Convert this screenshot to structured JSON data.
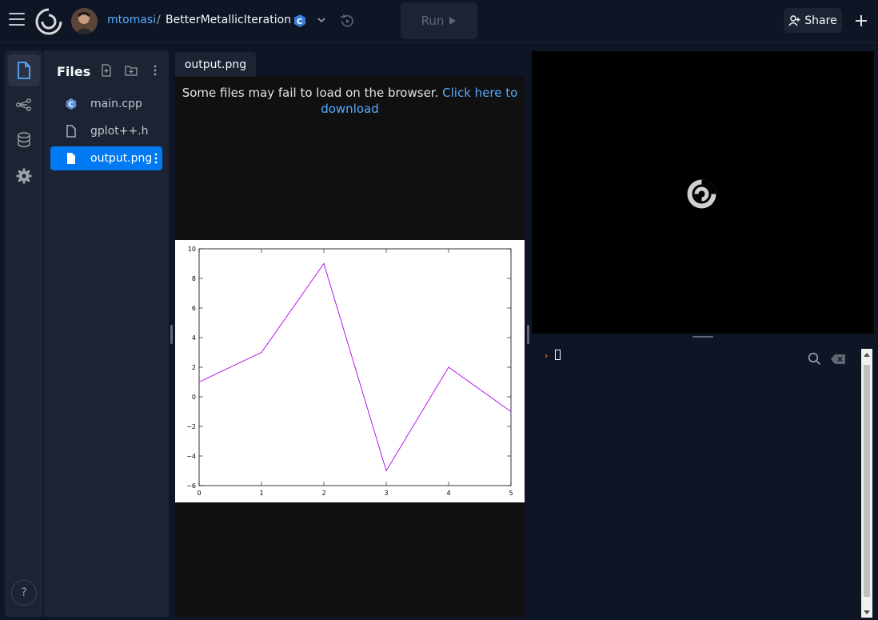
{
  "header": {
    "username": "mtomasi",
    "separator": "/",
    "repl_name": "BetterMetallicIteration",
    "run_label": "Run",
    "share_label": "Share"
  },
  "files": {
    "title": "Files",
    "items": [
      {
        "name": "main.cpp",
        "icon": "cpp-icon"
      },
      {
        "name": "gplot++.h",
        "icon": "file-icon"
      },
      {
        "name": "output.png",
        "icon": "file-icon",
        "selected": true
      }
    ]
  },
  "editor": {
    "tab_label": "output.png",
    "notice_text": "Some files may fail to load on the browser.",
    "notice_link": "Click here to download"
  },
  "console": {
    "prompt": "›"
  },
  "help_label": "?",
  "colors": {
    "accent": "#0079f2",
    "link": "#57abff",
    "background": "#0e1525",
    "panel": "#1c2333",
    "series": "#b000e8"
  },
  "chart_data": {
    "type": "line",
    "x": [
      0,
      1,
      2,
      3,
      4,
      5
    ],
    "series": [
      {
        "values": [
          1,
          3,
          9,
          -5,
          2,
          -1
        ]
      }
    ],
    "xticks": [
      "0",
      "1",
      "2",
      "3",
      "4",
      "5"
    ],
    "yticks": [
      "10",
      "8",
      "6",
      "4",
      "2",
      "0",
      "−2",
      "−4",
      "−6"
    ],
    "xlim": [
      0,
      5
    ],
    "ylim": [
      -6,
      10
    ]
  }
}
